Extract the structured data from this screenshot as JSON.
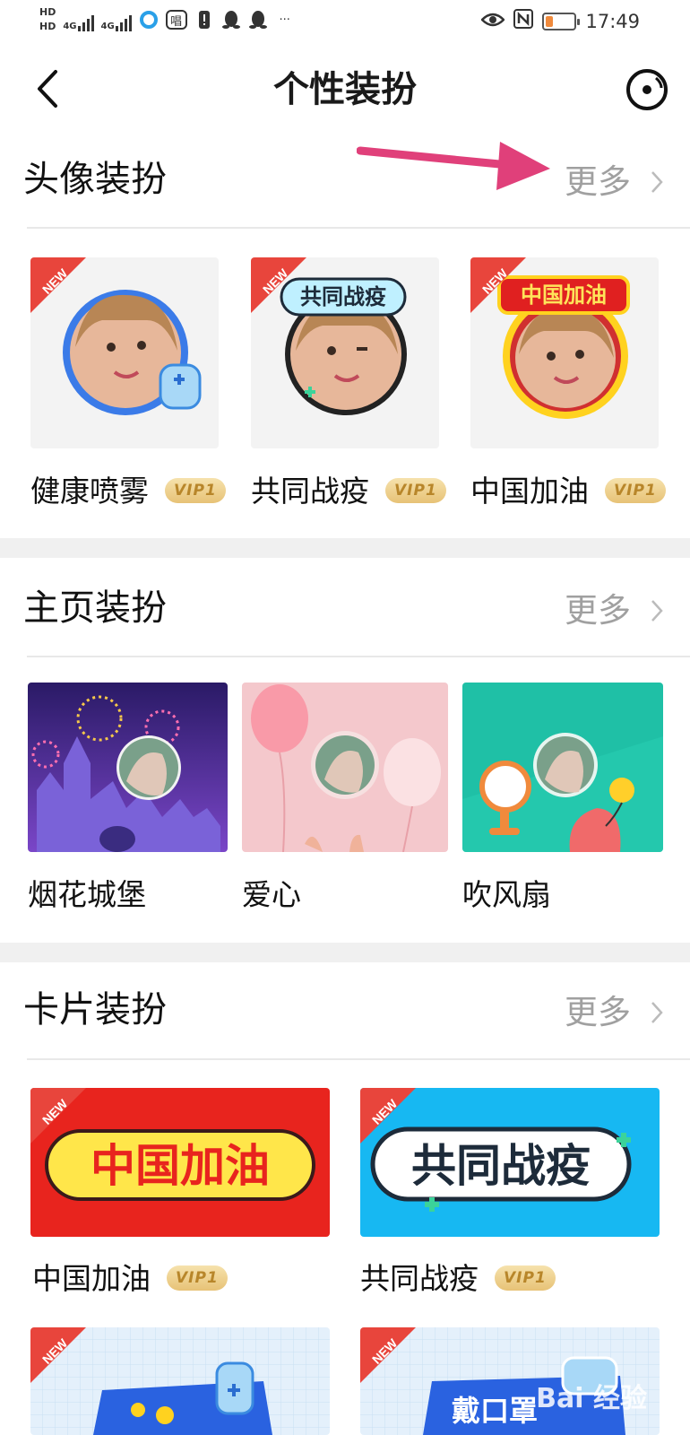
{
  "status_bar": {
    "hd1": "HD",
    "hd2": "HD",
    "net1": "4G",
    "net2": "4G",
    "time": "17:49",
    "battery_percent": 25,
    "icons": [
      "hd-icon",
      "signal-icon",
      "browser-icon",
      "sing-icon",
      "alert-icon",
      "qq-icon",
      "qq-icon",
      "more-dots-icon",
      "eye-icon",
      "nfc-icon",
      "battery-icon"
    ],
    "sing_label": "唱",
    "dots": "···"
  },
  "header": {
    "title": "个性装扮",
    "back_icon": "chevron-left-icon",
    "right_icon": "target-icon"
  },
  "avatar_section": {
    "title": "头像装扮",
    "more_label": "更多",
    "items": [
      {
        "label": "健康喷雾",
        "badge": "VIP1",
        "new": "NEW"
      },
      {
        "label": "共同战疫",
        "badge": "VIP1",
        "new": "NEW",
        "frame_text": "共同战疫"
      },
      {
        "label": "中国加油",
        "badge": "VIP1",
        "new": "NEW",
        "frame_text": "中国加油"
      }
    ]
  },
  "home_section": {
    "title": "主页装扮",
    "more_label": "更多",
    "items": [
      {
        "label": "烟花城堡"
      },
      {
        "label": "爱心"
      },
      {
        "label": "吹风扇"
      }
    ]
  },
  "card_section": {
    "title": "卡片装扮",
    "more_label": "更多",
    "items": [
      {
        "label": "中国加油",
        "badge": "VIP1",
        "new": "NEW",
        "card_text": "中国加油"
      },
      {
        "label": "共同战疫",
        "badge": "VIP1",
        "new": "NEW",
        "card_text": "共同战疫"
      },
      {
        "new": "NEW"
      },
      {
        "new": "NEW",
        "card_text": "戴口罩"
      }
    ]
  },
  "watermark": "Bai 经验",
  "colors": {
    "arrow": "#e0407a",
    "vip_text": "#b8862a",
    "new_ribbon": "#e8453c",
    "more_gray": "#a0a0a0",
    "band": "#f0f0f0"
  }
}
